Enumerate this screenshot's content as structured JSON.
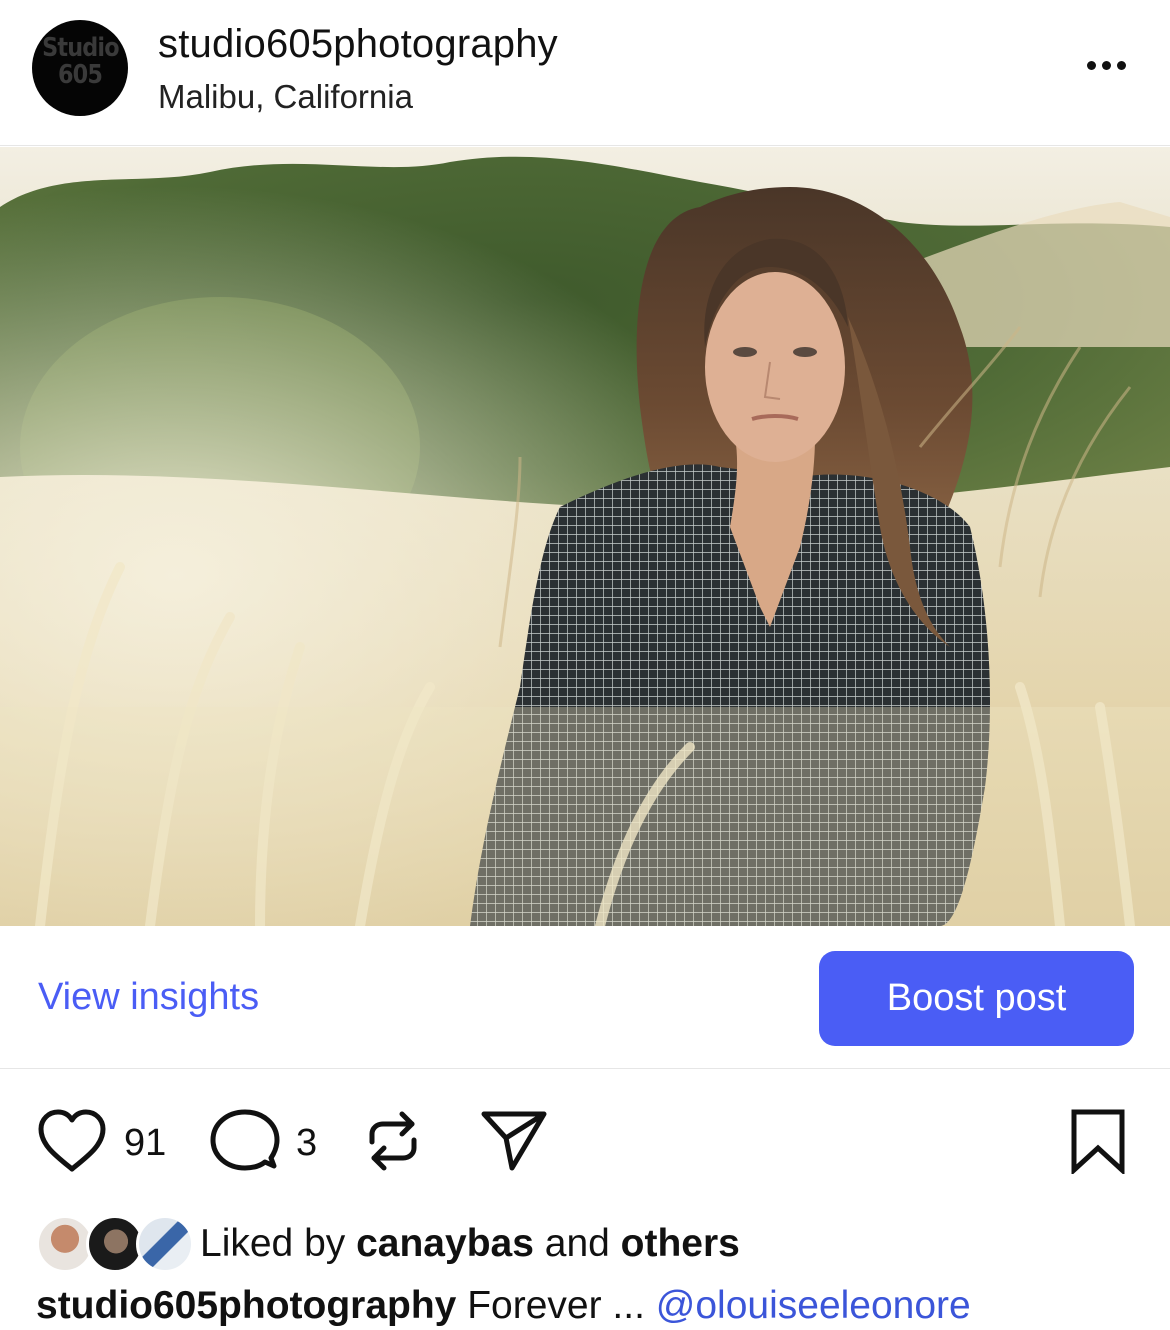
{
  "post": {
    "avatar_logo": [
      "Studio",
      "605"
    ],
    "username": "studio605photography",
    "location": "Malibu, California",
    "more_icon": "more-horizontal-icon"
  },
  "insights": {
    "view_label": "View insights",
    "boost_label": "Boost post",
    "accent_color": "#4a5df5"
  },
  "actions": {
    "like_count": "91",
    "comment_count": "3",
    "icons": [
      "heart-icon",
      "comment-icon",
      "repost-icon",
      "send-icon",
      "bookmark-icon"
    ]
  },
  "likes": {
    "prefix": "Liked by",
    "first_user": "canaybas",
    "connector": "and",
    "others": "others"
  },
  "caption": {
    "username": "studio605photography",
    "text": "Forever ...",
    "mention": "@olouiseeleonore"
  }
}
